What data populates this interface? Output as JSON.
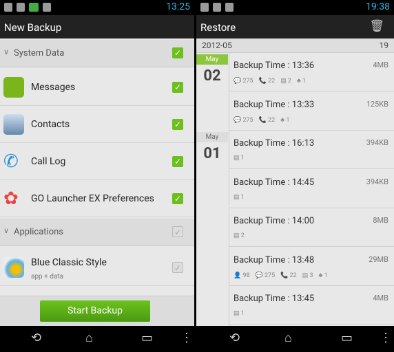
{
  "left": {
    "status_time": "13:25",
    "title": "New Backup",
    "system_section": "System Data",
    "applications_section": "Applications",
    "items": [
      {
        "label": "Messages",
        "icon": "messages-icon",
        "checked": true
      },
      {
        "label": "Contacts",
        "icon": "contacts-icon",
        "checked": true
      },
      {
        "label": "Call Log",
        "icon": "phone-icon",
        "checked": true
      },
      {
        "label": "GO Launcher EX Preferences",
        "icon": "go-launcher-icon",
        "checked": true
      }
    ],
    "app": {
      "label": "Blue Classic Style",
      "sub": "app + data",
      "checked": true,
      "disabled": true
    },
    "start_button": "Start Backup"
  },
  "right": {
    "status_time": "19:38",
    "title": "Restore",
    "month": "2012-05",
    "count": "19",
    "days": [
      {
        "month": "May",
        "day": "02"
      },
      {
        "month": "May",
        "day": "01"
      }
    ],
    "backups": [
      {
        "time": "Backup Time : 13:36",
        "size": "4MB",
        "stats": [
          "💬 275",
          "📞 22",
          "▤ 2",
          "♣ 1"
        ]
      },
      {
        "time": "Backup Time : 13:33",
        "size": "125KB",
        "stats": [
          "💬 275",
          "📞 22",
          "♣ 1"
        ]
      },
      {
        "time": "Backup Time : 16:13",
        "size": "394KB",
        "stats": [
          "▤ 1"
        ]
      },
      {
        "time": "Backup Time : 14:45",
        "size": "394KB",
        "stats": [
          "▤ 1"
        ]
      },
      {
        "time": "Backup Time : 14:00",
        "size": "8MB",
        "stats": [
          "▤ 2"
        ]
      },
      {
        "time": "Backup Time : 13:48",
        "size": "29MB",
        "stats": [
          "👤 98",
          "💬 275",
          "📞 22",
          "▤ 3",
          "♣ 1"
        ]
      },
      {
        "time": "Backup Time : 13:45",
        "size": "4MB",
        "stats": [
          "▤ 1"
        ]
      }
    ]
  },
  "colors": {
    "accent": "#33b5e5",
    "check": "#6cbf1c",
    "button": "#5aaf16",
    "today": "#8cc63f"
  }
}
